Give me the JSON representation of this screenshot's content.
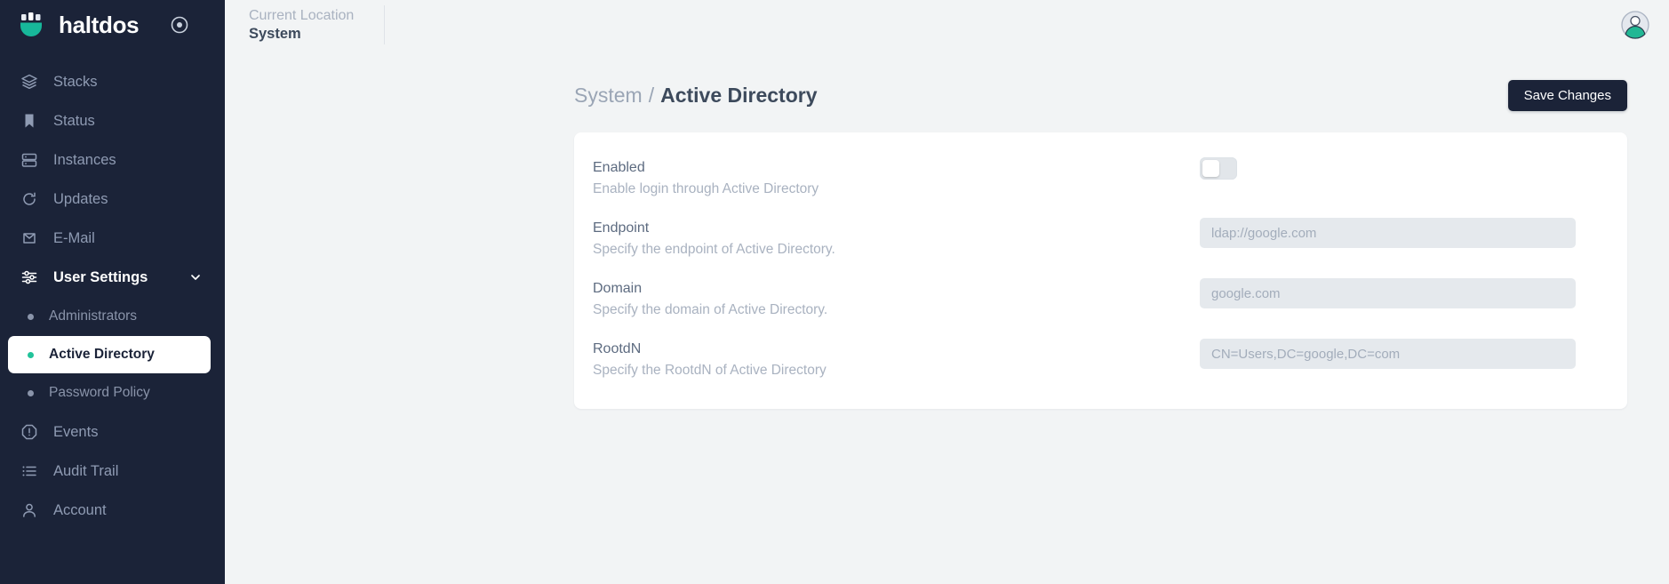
{
  "brand": {
    "name": "haltdos",
    "logo_icon": "haltdos-logo-icon",
    "target_icon": "target-icon"
  },
  "sidebar": {
    "items": [
      {
        "label": "Stacks",
        "icon": "layers-icon"
      },
      {
        "label": "Status",
        "icon": "bookmark-icon"
      },
      {
        "label": "Instances",
        "icon": "server-icon"
      },
      {
        "label": "Updates",
        "icon": "refresh-icon"
      },
      {
        "label": "E-Mail",
        "icon": "envelope-icon"
      },
      {
        "label": "User Settings",
        "icon": "sliders-icon",
        "expanded": true,
        "chevron": "chevron-down-icon"
      }
    ],
    "sub_items": [
      {
        "label": "Administrators",
        "selected": false
      },
      {
        "label": "Active Directory",
        "selected": true
      },
      {
        "label": "Password Policy",
        "selected": false
      }
    ],
    "items_bottom": [
      {
        "label": "Events",
        "icon": "alert-octagon-icon"
      },
      {
        "label": "Audit Trail",
        "icon": "list-icon"
      },
      {
        "label": "Account",
        "icon": "user-icon"
      }
    ]
  },
  "topbar": {
    "location_label": "Current Location",
    "location_value": "System",
    "avatar_icon": "user-avatar-icon"
  },
  "page": {
    "breadcrumb_parent": "System",
    "breadcrumb_separator": "/",
    "breadcrumb_current": "Active Directory",
    "save_label": "Save Changes"
  },
  "form": {
    "rows": [
      {
        "label": "Enabled",
        "description": "Enable login through Active Directory",
        "control": "toggle",
        "value": "off"
      },
      {
        "label": "Endpoint",
        "description": "Specify the endpoint of Active Directory.",
        "control": "input",
        "placeholder": "ldap://google.com",
        "value": ""
      },
      {
        "label": "Domain",
        "description": "Specify the domain of Active Directory.",
        "control": "input",
        "placeholder": "google.com",
        "value": ""
      },
      {
        "label": "RootdN",
        "description": "Specify the RootdN of Active Directory",
        "control": "input",
        "placeholder": "CN=Users,DC=google,DC=com",
        "value": ""
      }
    ]
  },
  "colors": {
    "sidebar_bg": "#1b2338",
    "accent_teal": "#22c39a",
    "page_bg": "#f2f4f5",
    "card_bg": "#ffffff",
    "button_bg": "#1b2338"
  }
}
